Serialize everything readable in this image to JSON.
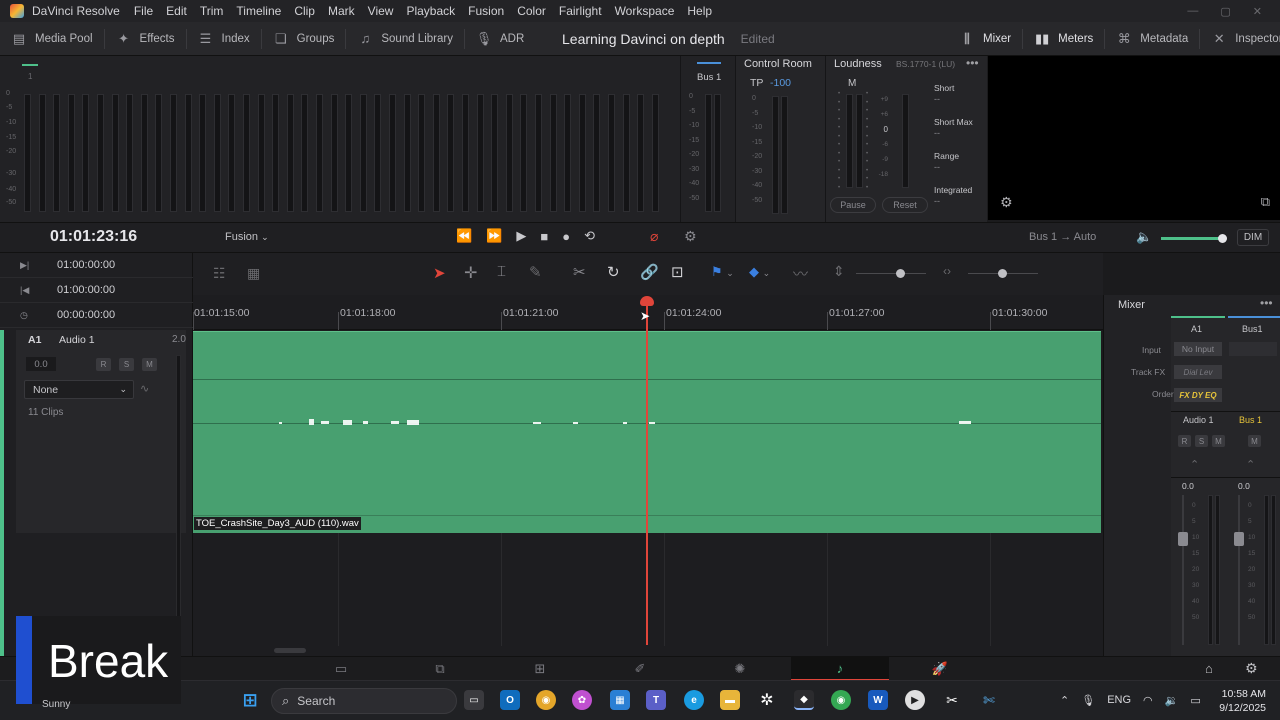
{
  "app": {
    "title": "DaVinci Resolve",
    "menu": [
      "File",
      "Edit",
      "Trim",
      "Timeline",
      "Clip",
      "Mark",
      "View",
      "Playback",
      "Fusion",
      "Color",
      "Fairlight",
      "Workspace",
      "Help"
    ]
  },
  "toolbar": {
    "left": [
      {
        "label": "Media Pool",
        "icon": "media-pool-icon"
      },
      {
        "label": "Effects",
        "icon": "effects-wand-icon"
      },
      {
        "label": "Index",
        "icon": "index-list-icon"
      },
      {
        "label": "Groups",
        "icon": "groups-icon"
      },
      {
        "label": "Sound Library",
        "icon": "sound-library-icon"
      },
      {
        "label": "ADR",
        "icon": "microphone-icon"
      }
    ],
    "project_title": "Learning Davinci on depth",
    "project_status": "Edited",
    "right": [
      {
        "label": "Mixer",
        "icon": "mixer-sliders-icon"
      },
      {
        "label": "Meters",
        "icon": "meters-icon"
      },
      {
        "label": "Metadata",
        "icon": "metadata-tag-icon"
      },
      {
        "label": "Inspector",
        "icon": "inspector-icon"
      }
    ]
  },
  "meters": {
    "scale": [
      "0",
      "-5",
      "-10",
      "-15",
      "-20",
      "-30",
      "-40",
      "-50"
    ],
    "bus_label": "Bus 1",
    "channel_marker": "1"
  },
  "control_room": {
    "title": "Control Room",
    "tp_label": "TP",
    "tp_value": "-100"
  },
  "loudness": {
    "title": "Loudness",
    "standard": "BS.1770-1 (LU)",
    "meter_label": "M",
    "scale": [
      "+9",
      "+6",
      "+3",
      "0",
      "-3",
      "-6",
      "-9",
      "-18"
    ],
    "readouts": [
      {
        "label": "Short",
        "value": "--"
      },
      {
        "label": "Short Max",
        "value": "--"
      },
      {
        "label": "Range",
        "value": "--"
      },
      {
        "label": "Integrated",
        "value": "--"
      }
    ],
    "pause_label": "Pause",
    "reset_label": "Reset"
  },
  "transport": {
    "timecode": "01:01:23:16",
    "track_select": "Fusion",
    "bus_route": "Bus 1",
    "automation": "Auto",
    "dim_label": "DIM",
    "volume_level": 0.92
  },
  "timecodes": [
    {
      "icon": "in-point-icon",
      "value": "01:00:00:00"
    },
    {
      "icon": "out-point-icon",
      "value": "01:00:00:00"
    },
    {
      "icon": "duration-clock-icon",
      "value": "00:00:00:00"
    }
  ],
  "track": {
    "id": "A1",
    "name": "Audio 1",
    "channels": "2.0",
    "volume": "0.0",
    "buttons": [
      "R",
      "S",
      "M"
    ],
    "input": "None",
    "clip_count": "11 Clips"
  },
  "ruler": {
    "labels": [
      "01:01:15:00",
      "01:01:18:00",
      "01:01:21:00",
      "01:01:24:00",
      "01:01:27:00",
      "01:01:30:00"
    ]
  },
  "clip": {
    "name": "TOE_CrashSite_Day3_AUD (110).wav"
  },
  "mixer": {
    "title": "Mixer",
    "strips": [
      {
        "header": "A1",
        "name": "Audio 1",
        "buttons": [
          "R",
          "S",
          "M"
        ],
        "gain": "0.0"
      },
      {
        "header": "Bus1",
        "name": "Bus 1",
        "buttons": [
          "M"
        ],
        "gain": "0.0"
      }
    ],
    "rows": [
      {
        "label": "Input",
        "value": "No Input"
      },
      {
        "label": "Track FX",
        "value": "Dial Lev"
      },
      {
        "label": "Order",
        "value": "FX DY EQ"
      }
    ],
    "fader_scale": [
      "0",
      "5",
      "10",
      "15",
      "20",
      "30",
      "40",
      "50"
    ]
  },
  "overlay": {
    "text": "Break"
  },
  "taskbar": {
    "search_placeholder": "Search",
    "weather": "Sunny",
    "lang": "ENG",
    "time": "10:58 AM",
    "date": "9/12/2025"
  },
  "colors": {
    "clip_green": "#48a070",
    "playhead_red": "#e0453a",
    "accent_blue": "#1f4fd0"
  }
}
